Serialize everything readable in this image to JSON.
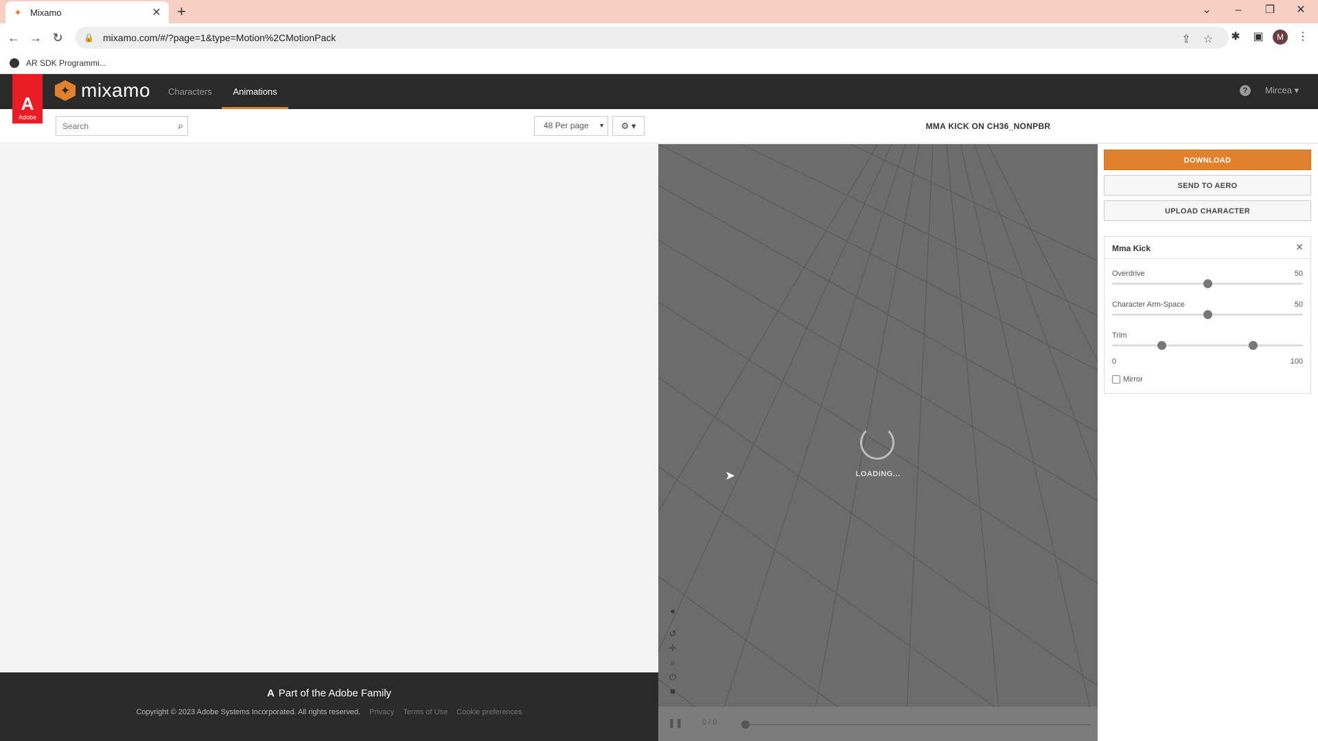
{
  "browser": {
    "tab_title": "Mixamo",
    "url": "mixamo.com/#/?page=1&type=Motion%2CMotionPack",
    "bookmark": "AR SDK Programmi...",
    "profile_initial": "M"
  },
  "header": {
    "adobe_label": "Adobe",
    "logo_text": "mixamo",
    "nav": [
      "Characters",
      "Animations"
    ],
    "active_nav": "Animations",
    "user": "Mircea ▾"
  },
  "left": {
    "search_placeholder": "Search",
    "per_page": "48 Per page",
    "gear_label": "⚙ ▾"
  },
  "footer": {
    "family": "Part of the Adobe Family",
    "copyright": "Copyright © 2023 Adobe Systems Incorporated. All rights reserved.",
    "links": [
      "Privacy",
      "Terms of Use",
      "Cookie preferences"
    ]
  },
  "viewer": {
    "title": "MMA KICK ON CH36_NONPBR",
    "loading": "LOADING...",
    "frames": "0 / 0"
  },
  "actions": {
    "download": "DOWNLOAD",
    "send": "SEND TO AERO",
    "upload": "UPLOAD CHARACTER"
  },
  "animation_card": {
    "name": "Mma Kick",
    "overdrive_label": "Overdrive",
    "overdrive_value": "50",
    "armspace_label": "Character Arm-Space",
    "armspace_value": "50",
    "trim_label": "Trim",
    "trim_min": "0",
    "trim_max": "100",
    "trim_start_fraction": 0.26,
    "trim_end_fraction": 0.74,
    "overdrive_fraction": 0.5,
    "armspace_fraction": 0.5,
    "mirror_label": "Mirror"
  },
  "colors": {
    "accent": "#e2812b",
    "header_bg": "#2a2a2a",
    "adobe_red": "#ec1c24"
  }
}
